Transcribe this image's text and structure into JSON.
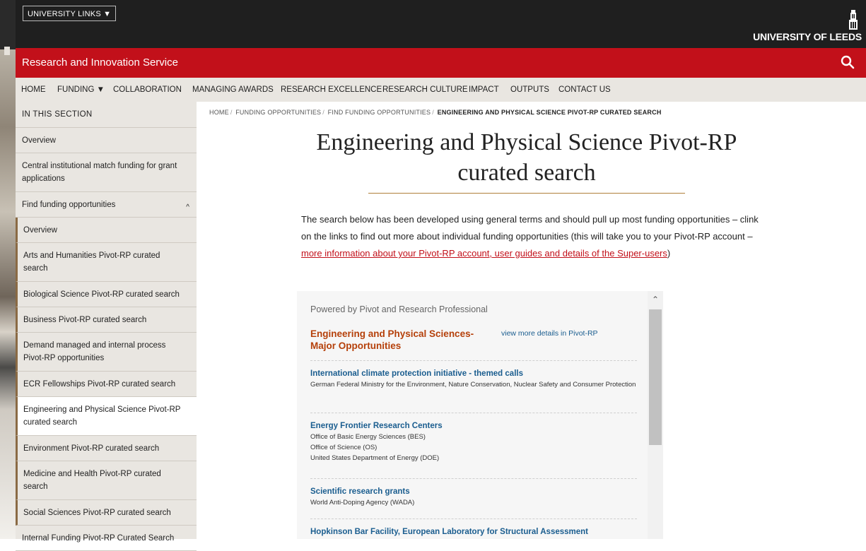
{
  "header": {
    "university_links": "UNIVERSITY LINKS ▼",
    "logo_text": "UNIVERSITY OF LEEDS",
    "site_title": "Research and Innovation Service",
    "search_icon": "search-icon"
  },
  "nav": {
    "items": [
      "HOME",
      "FUNDING ▼",
      "COLLABORATION",
      "MANAGING AWARDS",
      "RESEARCH EXCELLENCE",
      "RESEARCH CULTURE",
      "IMPACT",
      "OUTPUTS",
      "CONTACT US"
    ]
  },
  "sidebar": {
    "heading": "IN THIS SECTION",
    "items": [
      "Overview",
      "Central institutional match funding for grant applications",
      "Find funding opportunities"
    ],
    "sub_items": [
      "Overview",
      "Arts and Humanities Pivot-RP curated search",
      "Biological Science Pivot-RP curated search",
      "Business Pivot-RP curated search",
      "Demand managed and internal process Pivot-RP opportunities",
      "ECR Fellowships Pivot-RP curated search",
      "Engineering and Physical Science Pivot-RP curated search",
      "Environment Pivot-RP curated search",
      "Medicine and Health Pivot-RP curated search",
      "Social Sciences Pivot-RP curated search",
      "Internal Funding Pivot-RP Curated Search"
    ],
    "chevron": "^"
  },
  "breadcrumb": {
    "items": [
      "HOME",
      "FUNDING OPPORTUNITIES",
      "FIND FUNDING OPPORTUNITIES"
    ],
    "current": "ENGINEERING AND PHYSICAL SCIENCE PIVOT-RP CURATED SEARCH"
  },
  "main": {
    "title": "Engineering and Physical Science Pivot-RP curated search",
    "intro_text": "The search below has been developed using general terms and should pull up most funding opportunities – clink on the links to find out more about individual funding opportunities (this will take you to your Pivot-RP account – ",
    "intro_link": "more information about your Pivot-RP account, user guides and details of the Super-users",
    "intro_end": ")"
  },
  "widget": {
    "powered_by": "Powered by Pivot and Research Professional",
    "category_title": "Engineering and Physical Sciences- Major Opportunities",
    "view_more": "view more details in Pivot-RP",
    "opportunities": [
      {
        "title": "International climate protection initiative - themed calls",
        "sponsors": [
          "German Federal Ministry for the Environment, Nature Conservation, Nuclear Safety and Consumer Protection"
        ]
      },
      {
        "title": "Energy Frontier Research Centers",
        "sponsors": [
          "Office of Basic Energy Sciences (BES)",
          "Office of Science (OS)",
          "United States Department of Energy (DOE)"
        ]
      },
      {
        "title": "Scientific research grants",
        "sponsors": [
          "World Anti-Doping Agency (WADA)"
        ]
      },
      {
        "title": "Hopkinson Bar Facility, European Laboratory for Structural Assessment",
        "sponsors": []
      }
    ]
  }
}
